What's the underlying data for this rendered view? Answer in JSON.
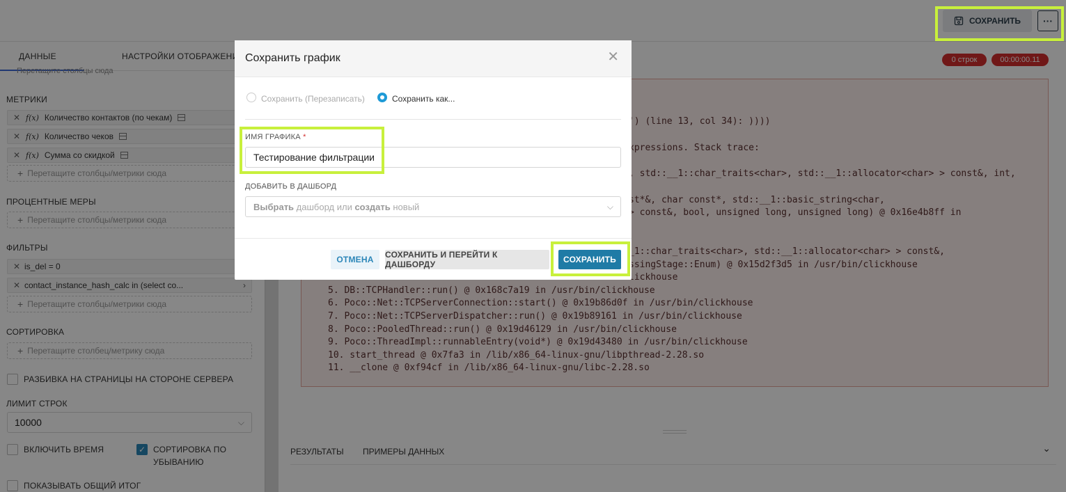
{
  "topbar": {
    "save_label": "СОХРАНИТЬ",
    "more_label": "···"
  },
  "left": {
    "tabs": [
      "ДАННЫЕ",
      "НАСТРОЙКИ ОТОБРАЖЕНИЯ"
    ],
    "drop_top": "Перетащите столбцы сюда",
    "metrics_label": "МЕТРИКИ",
    "metrics": [
      {
        "fx": "f(x)",
        "label": "Количество контактов (по чекам)"
      },
      {
        "fx": "f(x)",
        "label": "Количество чеков"
      },
      {
        "fx": "f(x)",
        "label": "Сумма со скидкой"
      }
    ],
    "drop_metrics": "Перетащите столбцы/метрики сюда",
    "percent_label": "ПРОЦЕНТНЫЕ МЕРЫ",
    "drop_percent": "Перетащите столбцы/метрики сюда",
    "filters_label": "ФИЛЬТРЫ",
    "filters": [
      "is_del = 0",
      "contact_instance_hash_calc in (select co..."
    ],
    "drop_filters": "Перетащите столбцы/метрики сюда",
    "sort_label": "СОРТИРОВКА",
    "drop_sort": "Перетащите столбец/метрику сюда",
    "server_paging": "РАЗБИВКА НА СТРАНИЦЫ НА СТОРОНЕ СЕРВЕРА",
    "row_limit_label": "ЛИМИТ СТРОК",
    "row_limit_value": "10000",
    "include_time": "ВКЛЮЧИТЬ ВРЕМЯ",
    "sort_desc_line1": "СОРТИРОВКА ПО",
    "sort_desc_line2": "УБЫВАНИЮ",
    "show_total": "ПОКАЗЫВАТЬ ОБЩИЙ ИТОГ"
  },
  "right": {
    "rows_badge": "0 строк",
    "time_badge": "00:00:00.11",
    "error_lines": [
      "') (line 13, col 34): ))))",
      "xpressions. Stack trace:",
      ", std::__1::char_traits<char>, std::__1::allocator<char> > const&, int,",
      "st*&, char const*, std::__1::basic_string<char,",
      "> const&, bool, unsigned long, unsigned long) @ 0x16e4b8ff in",
      "_1::char_traits<char>, std::__1::allocator<char> > const&,",
      "ssingStage::Enum) @ 0x15d2f3d5 in /usr/bin/clickhouse",
      "lickhouse",
      "5. DB::TCPHandler::run() @ 0x168c7a19 in /usr/bin/clickhouse",
      "6. Poco::Net::TCPServerConnection::start() @ 0x19b86d0f in /usr/bin/clickhouse",
      "7. Poco::Net::TCPServerDispatcher::run() @ 0x19b89161 in /usr/bin/clickhouse",
      "8. Poco::PooledThread::run() @ 0x19d46129 in /usr/bin/clickhouse",
      "9. Poco::ThreadImpl::runnableEntry(void*) @ 0x19d43480 in /usr/bin/clickhouse",
      "10. start_thread @ 0x7fa3 in /lib/x86_64-linux-gnu/libpthread-2.28.so",
      "11. __clone @ 0xf94cf in /lib/x86_64-linux-gnu/libc-2.28.so"
    ],
    "result_tabs": [
      "РЕЗУЛЬТАТЫ",
      "ПРИМЕРЫ ДАННЫХ"
    ]
  },
  "modal": {
    "title": "Сохранить график",
    "radio_overwrite": "Сохранить (Перезаписать)",
    "radio_save_as": "Сохранить как...",
    "name_label": "ИМЯ ГРАФИКА",
    "required_mark": "*",
    "name_value": "Тестирование фильтрации",
    "dashboard_label": "ДОБАВИТЬ В ДАШБОРД",
    "dashboard_ph_1": "Выбрать",
    "dashboard_ph_2": " дашборд или ",
    "dashboard_ph_3": "создать",
    "dashboard_ph_4": " новый",
    "cancel": "ОТМЕНА",
    "save_and_go": "СОХРАНИТЬ И ПЕРЕЙТИ К ДАШБОРДУ",
    "save": "СОХРАНИТЬ"
  },
  "colors": {
    "highlight": "#c8f03c",
    "primary": "#1f7ba6",
    "badge": "#d32f2f"
  }
}
